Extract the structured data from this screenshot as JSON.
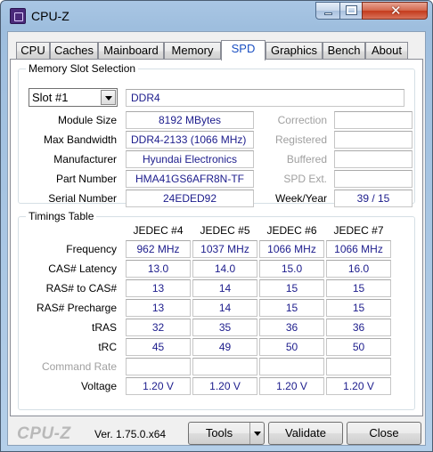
{
  "window": {
    "title": "CPU-Z"
  },
  "tabs": [
    "CPU",
    "Caches",
    "Mainboard",
    "Memory",
    "SPD",
    "Graphics",
    "Bench",
    "About"
  ],
  "active_tab": "SPD",
  "slot_selection": {
    "legend": "Memory Slot Selection",
    "selected_slot": "Slot #1",
    "memory_type": "DDR4",
    "fields": {
      "module_size": {
        "label": "Module Size",
        "value": "8192 MBytes"
      },
      "max_bandwidth": {
        "label": "Max Bandwidth",
        "value": "DDR4-2133 (1066 MHz)"
      },
      "manufacturer": {
        "label": "Manufacturer",
        "value": "Hyundai Electronics"
      },
      "part_number": {
        "label": "Part Number",
        "value": "HMA41GS6AFR8N-TF"
      },
      "serial_number": {
        "label": "Serial Number",
        "value": "24EDED92"
      }
    },
    "right_fields": {
      "correction": {
        "label": "Correction",
        "value": ""
      },
      "registered": {
        "label": "Registered",
        "value": ""
      },
      "buffered": {
        "label": "Buffered",
        "value": ""
      },
      "spd_ext": {
        "label": "SPD Ext.",
        "value": ""
      },
      "week_year": {
        "label": "Week/Year",
        "value": "39 / 15"
      }
    }
  },
  "timings": {
    "legend": "Timings Table",
    "columns": [
      "JEDEC #4",
      "JEDEC #5",
      "JEDEC #6",
      "JEDEC #7"
    ],
    "rows": [
      {
        "label": "Frequency",
        "values": [
          "962 MHz",
          "1037 MHz",
          "1066 MHz",
          "1066 MHz"
        ]
      },
      {
        "label": "CAS# Latency",
        "values": [
          "13.0",
          "14.0",
          "15.0",
          "16.0"
        ]
      },
      {
        "label": "RAS# to CAS#",
        "values": [
          "13",
          "14",
          "15",
          "15"
        ]
      },
      {
        "label": "RAS# Precharge",
        "values": [
          "13",
          "14",
          "15",
          "15"
        ]
      },
      {
        "label": "tRAS",
        "values": [
          "32",
          "35",
          "36",
          "36"
        ]
      },
      {
        "label": "tRC",
        "values": [
          "45",
          "49",
          "50",
          "50"
        ]
      },
      {
        "label": "Command Rate",
        "values": [
          "",
          "",
          "",
          ""
        ]
      },
      {
        "label": "Voltage",
        "values": [
          "1.20 V",
          "1.20 V",
          "1.20 V",
          "1.20 V"
        ]
      }
    ]
  },
  "footer": {
    "logo": "CPU-Z",
    "version": "Ver. 1.75.0.x64",
    "tools_label": "Tools",
    "validate_label": "Validate",
    "close_label": "Close"
  }
}
